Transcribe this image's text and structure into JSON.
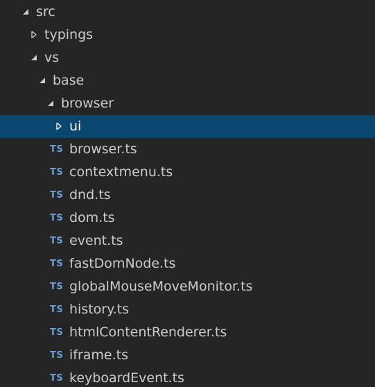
{
  "explorer": {
    "src": {
      "label": "src",
      "state": "expanded"
    },
    "typings": {
      "label": "typings",
      "state": "collapsed"
    },
    "vs": {
      "label": "vs",
      "state": "expanded"
    },
    "base": {
      "label": "base",
      "state": "expanded"
    },
    "browser": {
      "label": "browser",
      "state": "expanded"
    },
    "ui": {
      "label": "ui",
      "state": "collapsed",
      "selected": true
    },
    "file_badge": "TS",
    "files": [
      "browser.ts",
      "contextmenu.ts",
      "dnd.ts",
      "dom.ts",
      "event.ts",
      "fastDomNode.ts",
      "globalMouseMoveMonitor.ts",
      "history.ts",
      "htmlContentRenderer.ts",
      "iframe.ts",
      "keyboardEvent.ts"
    ]
  },
  "colors": {
    "background": "#252526",
    "selection": "#094771",
    "text": "#cccccc",
    "ts_badge": "#6a9fd8"
  }
}
